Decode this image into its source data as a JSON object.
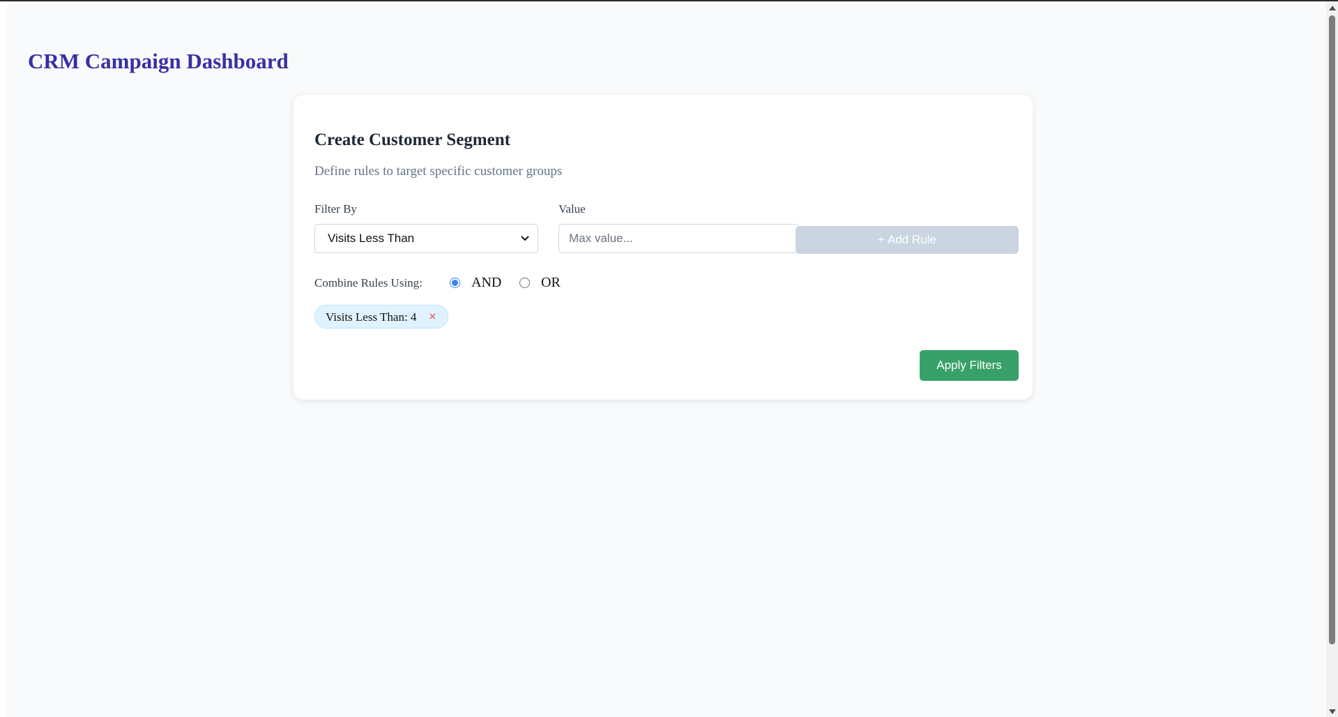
{
  "header": {
    "title": "CRM Campaign Dashboard"
  },
  "segment_card": {
    "title": "Create Customer Segment",
    "subtitle": "Define rules to target specific customer groups",
    "filter_by": {
      "label": "Filter By",
      "selected": "Visits Less Than"
    },
    "value": {
      "label": "Value",
      "placeholder": "Max value...",
      "current": ""
    },
    "add_rule_label": "+ Add Rule",
    "combine": {
      "label": "Combine Rules Using:",
      "options": [
        {
          "label": "AND",
          "selected": true
        },
        {
          "label": "OR",
          "selected": false
        }
      ]
    },
    "rules": [
      {
        "label": "Visits Less Than: 4",
        "remove_glyph": "×"
      }
    ],
    "apply_label": "Apply Filters"
  },
  "colors": {
    "title": "#3730a3",
    "apply_button": "#38a169",
    "add_rule_disabled": "#cbd5e1",
    "chip_background": "#e0f2fe",
    "remove_icon": "#ef4444",
    "radio_selected": "#3b82f6"
  }
}
